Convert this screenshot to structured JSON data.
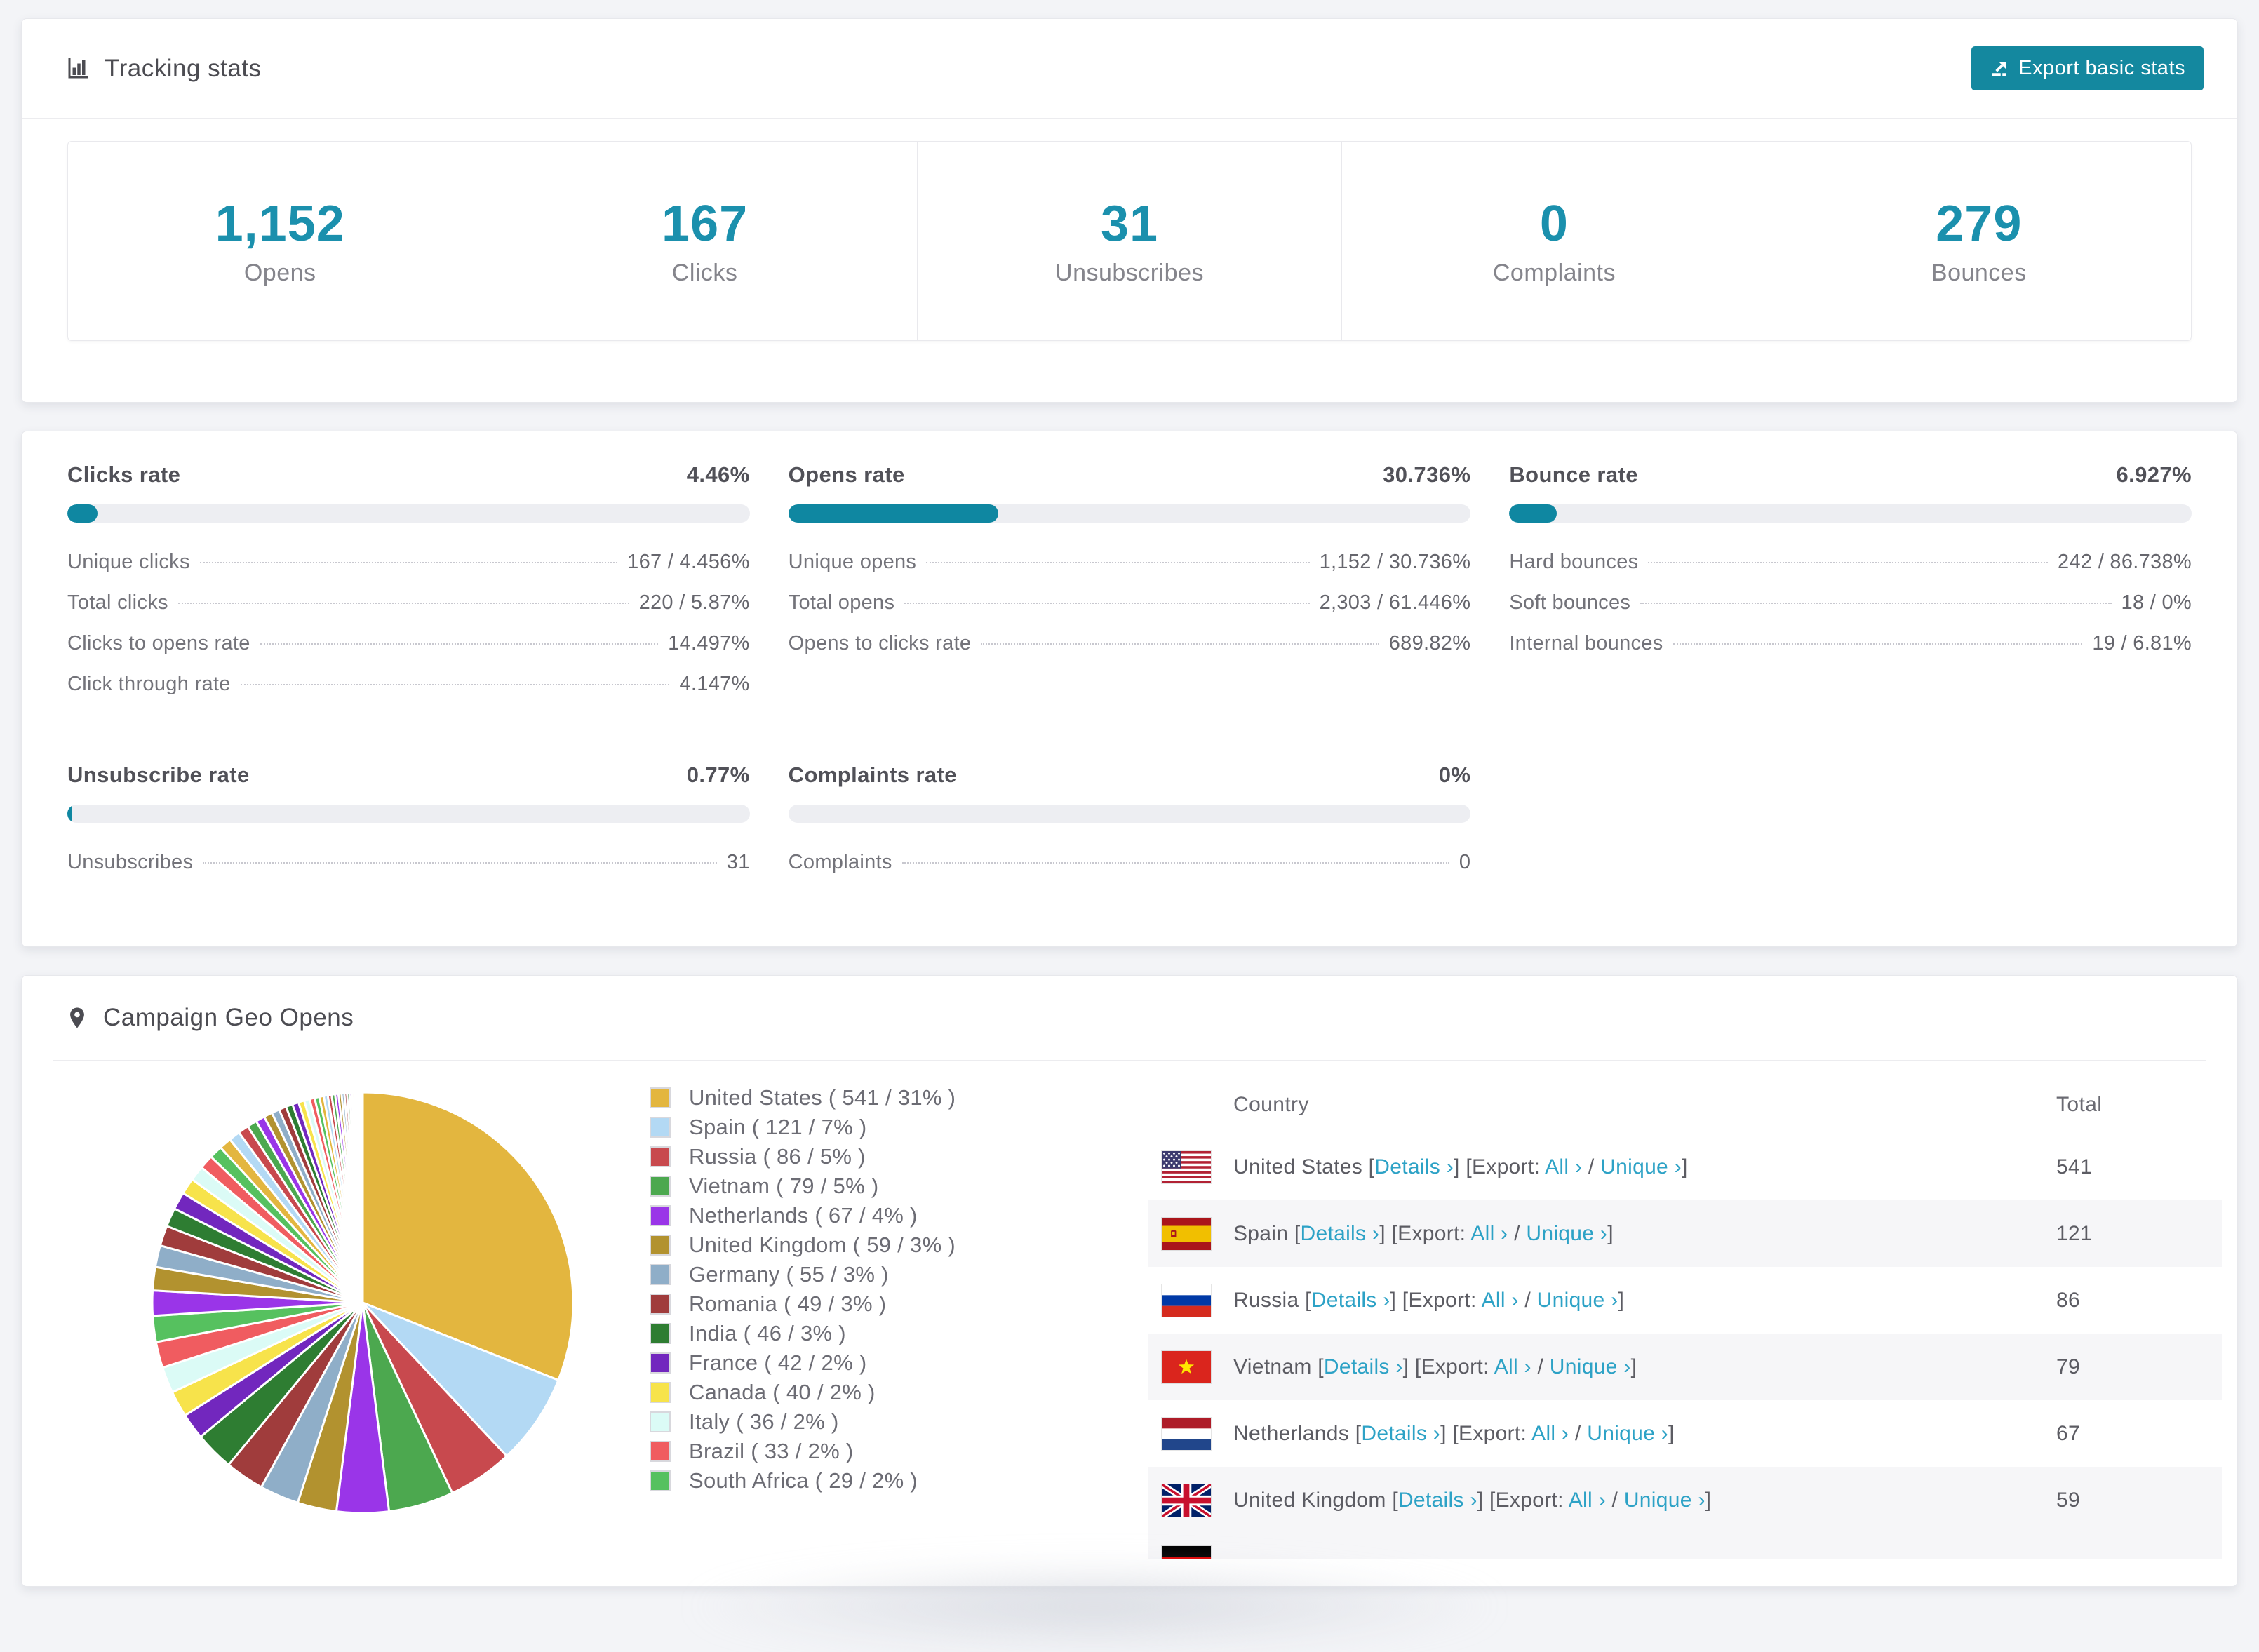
{
  "colors": {
    "accent": "#14889f",
    "stat_number": "#1b90ad",
    "link": "#2da2c6",
    "bar_track": "#edeef2",
    "row_alt": "#f6f6f8"
  },
  "tracking": {
    "title": "Tracking stats",
    "export_button": "Export basic stats",
    "stats": [
      {
        "value": "1,152",
        "label": "Opens"
      },
      {
        "value": "167",
        "label": "Clicks"
      },
      {
        "value": "31",
        "label": "Unsubscribes"
      },
      {
        "value": "0",
        "label": "Complaints"
      },
      {
        "value": "279",
        "label": "Bounces"
      }
    ]
  },
  "rates": {
    "clicks": {
      "title": "Clicks rate",
      "value": "4.46%",
      "pct": 4.46,
      "rows": [
        {
          "label": "Unique clicks",
          "value": "167 / 4.456%"
        },
        {
          "label": "Total clicks",
          "value": "220 / 5.87%"
        },
        {
          "label": "Clicks to opens rate",
          "value": "14.497%"
        },
        {
          "label": "Click through rate",
          "value": "4.147%"
        }
      ]
    },
    "opens": {
      "title": "Opens rate",
      "value": "30.736%",
      "pct": 30.736,
      "rows": [
        {
          "label": "Unique opens",
          "value": "1,152 / 30.736%"
        },
        {
          "label": "Total opens",
          "value": "2,303 / 61.446%"
        },
        {
          "label": "Opens to clicks rate",
          "value": "689.82%"
        }
      ]
    },
    "bounce": {
      "title": "Bounce rate",
      "value": "6.927%",
      "pct": 6.927,
      "rows": [
        {
          "label": "Hard bounces",
          "value": "242 / 86.738%"
        },
        {
          "label": "Soft bounces",
          "value": "18 / 0%"
        },
        {
          "label": "Internal bounces",
          "value": "19 / 6.81%"
        }
      ]
    },
    "unsubscribe": {
      "title": "Unsubscribe rate",
      "value": "0.77%",
      "pct": 0.77,
      "rows": [
        {
          "label": "Unsubscribes",
          "value": "31"
        }
      ]
    },
    "complaints": {
      "title": "Complaints rate",
      "value": "0%",
      "pct": 0,
      "rows": [
        {
          "label": "Complaints",
          "value": "0"
        }
      ]
    }
  },
  "geo": {
    "title": "Campaign Geo Opens",
    "legend": [
      {
        "label": "United States ( 541 / 31% )",
        "color": "#e3b63f"
      },
      {
        "label": "Spain ( 121 / 7% )",
        "color": "#b3d9f4"
      },
      {
        "label": "Russia ( 86 / 5% )",
        "color": "#c8494e"
      },
      {
        "label": "Vietnam ( 79 / 5% )",
        "color": "#4ca84f"
      },
      {
        "label": "Netherlands ( 67 / 4% )",
        "color": "#9a35e8"
      },
      {
        "label": "United Kingdom ( 59 / 3% )",
        "color": "#b2922f"
      },
      {
        "label": "Germany ( 55 / 3% )",
        "color": "#8faec8"
      },
      {
        "label": "Romania ( 49 / 3% )",
        "color": "#a03c3c"
      },
      {
        "label": "India ( 46 / 3% )",
        "color": "#2e7d32"
      },
      {
        "label": "France ( 42 / 2% )",
        "color": "#7227be"
      },
      {
        "label": "Canada ( 40 / 2% )",
        "color": "#f7e34b"
      },
      {
        "label": "Italy ( 36 / 2% )",
        "color": "#dbfbf6"
      },
      {
        "label": "Brazil ( 33 / 2% )",
        "color": "#f05c60"
      },
      {
        "label": "South Africa ( 29 / 2% )",
        "color": "#56c15f"
      }
    ],
    "table": {
      "headers": {
        "country": "Country",
        "total": "Total"
      },
      "links": {
        "open": "[",
        "close": "]",
        "details": "Details ›",
        "export": "Export:",
        "all": "All ›",
        "slash": "/",
        "unique": "Unique ›"
      },
      "rows": [
        {
          "flag": "us",
          "country": "United States",
          "total": "541"
        },
        {
          "flag": "es",
          "country": "Spain",
          "total": "121"
        },
        {
          "flag": "ru",
          "country": "Russia",
          "total": "86"
        },
        {
          "flag": "vn",
          "country": "Vietnam",
          "total": "79"
        },
        {
          "flag": "nl",
          "country": "Netherlands",
          "total": "67"
        },
        {
          "flag": "gb",
          "country": "United Kingdom",
          "total": "59"
        }
      ],
      "cut_row_flag": "de"
    }
  },
  "chart_data": {
    "type": "pie",
    "title": "Campaign Geo Opens",
    "labels": [
      "United States",
      "Spain",
      "Russia",
      "Vietnam",
      "Netherlands",
      "United Kingdom",
      "Germany",
      "Romania",
      "India",
      "France",
      "Canada",
      "Italy",
      "Brazil",
      "South Africa"
    ],
    "values": [
      541,
      121,
      86,
      79,
      67,
      59,
      55,
      49,
      46,
      42,
      40,
      36,
      33,
      29
    ],
    "pct": [
      31,
      7,
      5,
      5,
      4,
      3,
      3,
      3,
      3,
      2,
      2,
      2,
      2,
      2
    ],
    "others_pct": 26,
    "colors": [
      "#e3b63f",
      "#b3d9f4",
      "#c8494e",
      "#4ca84f",
      "#9a35e8",
      "#b2922f",
      "#8faec8",
      "#a03c3c",
      "#2e7d32",
      "#7227be",
      "#f7e34b",
      "#dbfbf6",
      "#f05c60",
      "#56c15f"
    ],
    "legend_position": "right",
    "start_angle_deg": 0,
    "direction": "clockwise"
  }
}
